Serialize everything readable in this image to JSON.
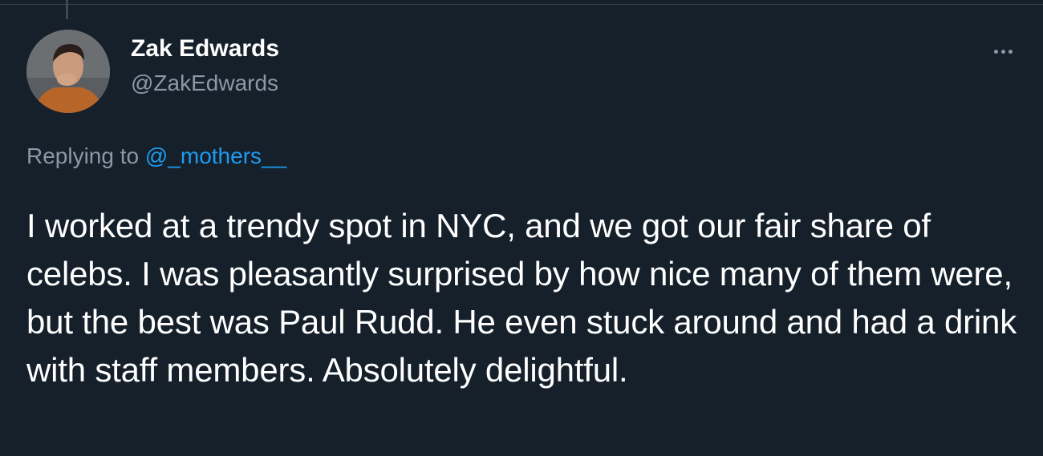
{
  "tweet": {
    "author_name": "Zak Edwards",
    "author_handle": "@ZakEdwards",
    "reply_prefix": "Replying to",
    "reply_to_handle": "@_mothers__",
    "text": "I worked at a trendy spot in NYC, and we got our fair share of celebs. I was pleasantly surprised by how nice many of them were, but the best was Paul Rudd. He even stuck around and had a drink with staff members. Absolutely delightful."
  },
  "icons": {
    "more": "more-horizontal-icon"
  },
  "colors": {
    "background": "#15202b",
    "text_primary": "#ffffff",
    "text_secondary": "#8b98a5",
    "link": "#1d9bf0"
  }
}
